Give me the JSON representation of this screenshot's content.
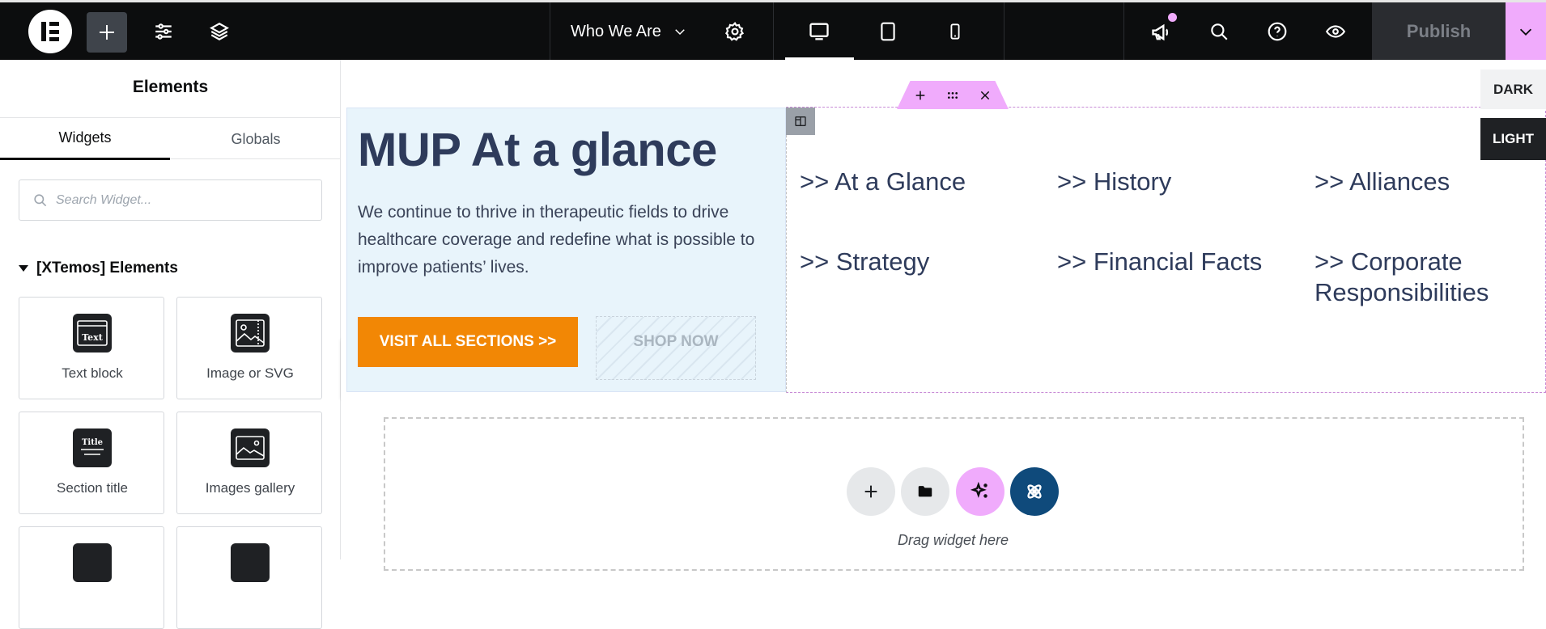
{
  "topbar": {
    "page_name": "Who We Are",
    "publish_label": "Publish",
    "icons": [
      "elementor-logo-icon",
      "plus-icon",
      "sliders-icon",
      "layers-icon",
      "chevron-down-icon",
      "gear-icon",
      "desktop-icon",
      "tablet-icon",
      "mobile-icon",
      "megaphone-icon",
      "search-icon",
      "help-icon",
      "eye-icon",
      "chevron-down-icon"
    ],
    "accent_color": "#f0abfc"
  },
  "sidebar": {
    "title": "Elements",
    "tabs": [
      {
        "label": "Widgets",
        "active": true
      },
      {
        "label": "Globals",
        "active": false
      }
    ],
    "search_placeholder": "Search Widget...",
    "category": "[XTemos] Elements",
    "widgets": [
      {
        "label": "Text block",
        "icon": "text-block-icon",
        "icon_text": "Text"
      },
      {
        "label": "Image or SVG",
        "icon": "image-icon"
      },
      {
        "label": "Section title",
        "icon": "section-title-icon",
        "icon_text": "Title"
      },
      {
        "label": "Images gallery",
        "icon": "gallery-icon"
      }
    ]
  },
  "canvas": {
    "hero": {
      "title": "MUP At a glance",
      "text": "We continue to thrive in therapeutic fields to drive healthcare coverage and redefine what is possible to improve patients’ lives.",
      "primary_button": "VISIT ALL SECTIONS >>",
      "secondary_button": "SHOP NOW",
      "primary_color": "#f28705"
    },
    "links": [
      ">> At a Glance",
      ">> History",
      ">> Alliances",
      ">> Strategy",
      ">> Financial Facts",
      ">> Corporate Responsibilities"
    ],
    "mode_toggle": {
      "dark": "DARK",
      "light": "LIGHT"
    },
    "dropzone_text": "Drag widget here"
  }
}
